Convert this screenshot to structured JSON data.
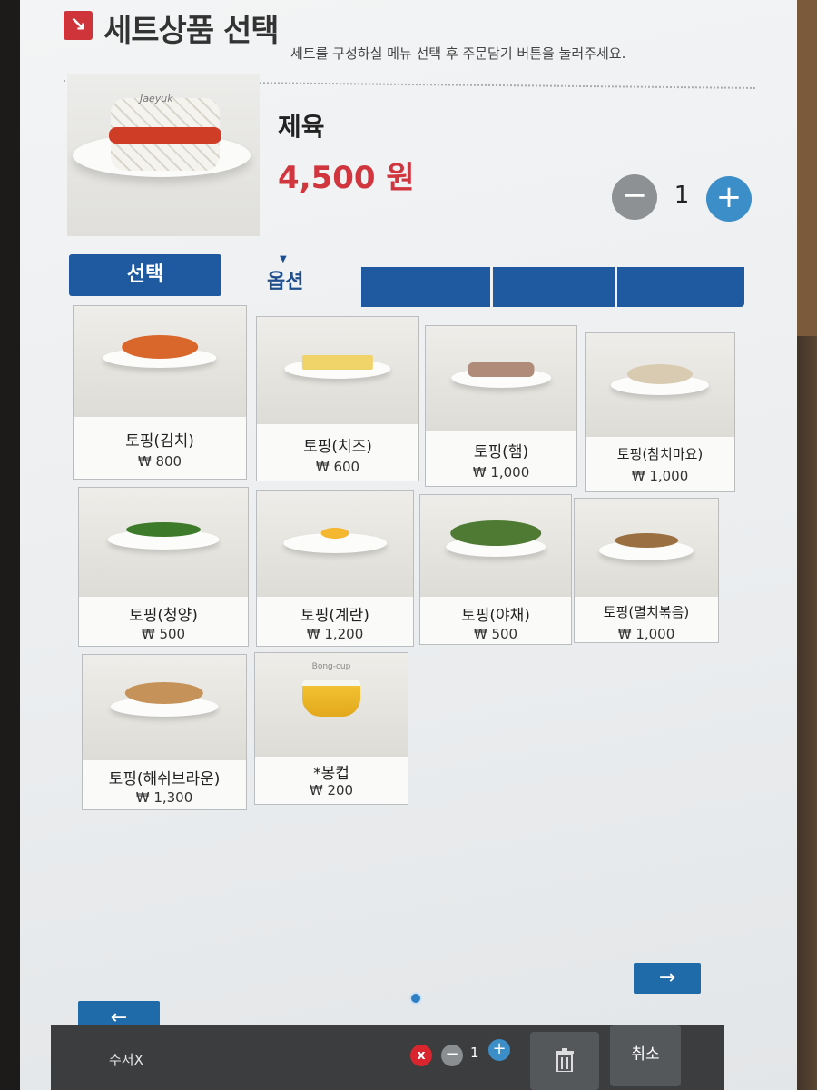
{
  "header": {
    "title": "세트상품 선택",
    "subtitle": "세트를 구성하실 메뉴 선택 후 주문담기 버튼을 눌러주세요."
  },
  "product": {
    "image_label": "Jaeyuk",
    "name": "제육",
    "price": "4,500 원",
    "quantity": "1",
    "minus_icon": "minus-icon",
    "plus_icon": "plus-icon"
  },
  "tabs": {
    "select": "선택",
    "option": "옵션"
  },
  "items": [
    {
      "name": "토핑(김치)",
      "price": "₩ 800",
      "food_color": "#d9662a"
    },
    {
      "name": "토핑(치즈)",
      "price": "₩ 600",
      "food_color": "#f0d46a"
    },
    {
      "name": "토핑(햄)",
      "price": "₩ 1,000",
      "food_color": "#b08b7a"
    },
    {
      "name": "토핑(참치마요)",
      "price": "₩ 1,000",
      "food_color": "#d8cbb2"
    },
    {
      "name": "토핑(청양)",
      "price": "₩ 500",
      "food_color": "#3d7a2a"
    },
    {
      "name": "토핑(계란)",
      "price": "₩ 1,200",
      "food_color": "#f5b630"
    },
    {
      "name": "토핑(야채)",
      "price": "₩ 500",
      "food_color": "#4f7a34"
    },
    {
      "name": "토핑(멸치볶음)",
      "price": "₩ 1,000",
      "food_color": "#9a7043"
    },
    {
      "name": "토핑(해쉬브라운)",
      "price": "₩ 1,300",
      "food_color": "#c59359"
    },
    {
      "name": "*봉컵",
      "price": "₩ 200",
      "cup_label": "Bong-cup"
    }
  ],
  "navigation": {
    "next_icon": "arrow-right-icon",
    "prev_icon": "arrow-left-icon",
    "next_symbol": "→",
    "prev_symbol": "←"
  },
  "bottom_bar": {
    "item_name": "수저X",
    "quantity": "1",
    "cancel_label": "취소",
    "remove_symbol": "x",
    "minus_symbol": "−",
    "plus_symbol": "+"
  },
  "colors": {
    "brand_blue": "#1f5aa0",
    "price_red": "#d1353d",
    "plus_blue": "#3c8ec8"
  }
}
